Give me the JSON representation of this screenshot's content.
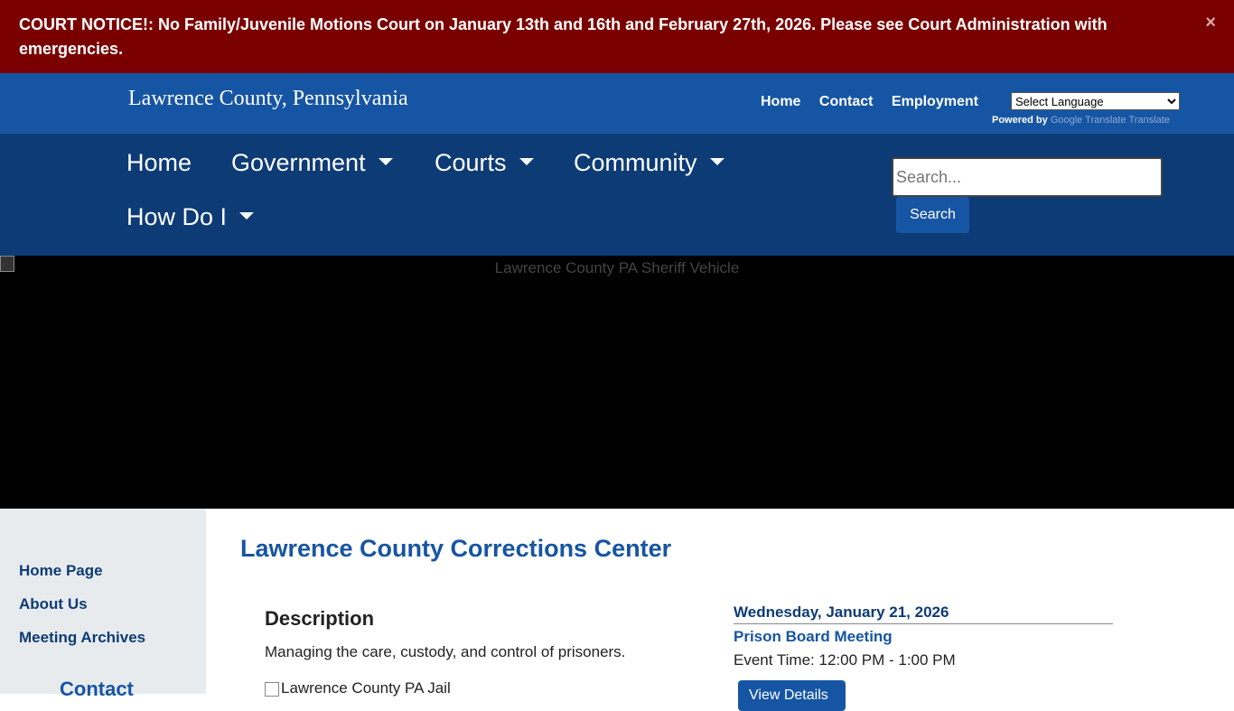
{
  "notice": {
    "text": "COURT NOTICE!:  No Family/Juvenile Motions Court on January 13th and 16th and February 27th, 2026.  Please see Court Administration with emergencies.",
    "close": "×"
  },
  "header": {
    "site_title": "Lawrence County, Pennsylvania",
    "util_links": [
      "Home",
      "Contact",
      "Employment"
    ],
    "language_select": "Select Language",
    "powered_by": "Powered by",
    "translate_alt": "Google Translate Translate"
  },
  "nav": {
    "items": [
      "Home",
      "Government",
      "Courts",
      "Community",
      "How Do I"
    ],
    "search_placeholder": "Search...",
    "search_button": "Search"
  },
  "hero": {
    "alt": "Lawrence County PA Sheriff Vehicle"
  },
  "sidebar": {
    "links": [
      "Home Page",
      "About Us",
      "Meeting Archives"
    ],
    "contact_heading": "Contact"
  },
  "main": {
    "title": "Lawrence County Corrections Center",
    "description_heading": "Description",
    "description_text": "Managing the care, custody, and control of prisoners.",
    "image_alt": "Lawrence County PA Jail"
  },
  "event": {
    "date": "Wednesday, January 21, 2026",
    "title": "Prison Board Meeting",
    "time_label": "Event Time:",
    "time_value": "12:00 PM - 1:00 PM",
    "button": "View Details"
  }
}
